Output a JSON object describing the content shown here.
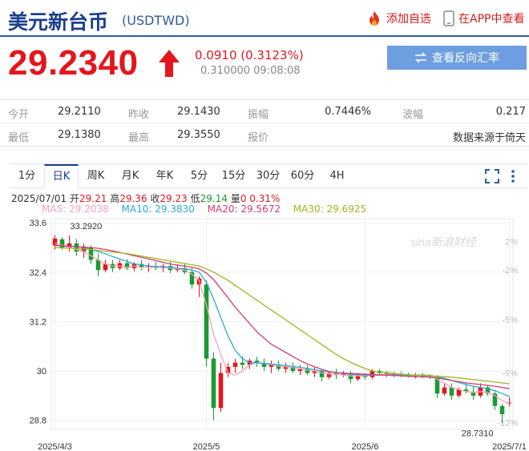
{
  "header": {
    "title": "美元新台币",
    "code": "(USDTWD)",
    "add_fav": "添加自选",
    "app_link": "在APP中查看"
  },
  "quote": {
    "price": "29.2340",
    "change": "0.0910 (0.3123%)",
    "subinfo": "0.310000 09:08:08",
    "reverse_button": "查看反向汇率"
  },
  "table": {
    "row1": [
      {
        "label": "今开",
        "value": "29.2110"
      },
      {
        "label": "昨收",
        "value": "29.1430"
      },
      {
        "label": "振幅",
        "value": "0.7446%"
      },
      {
        "label": "波幅",
        "value": "0.217"
      }
    ],
    "row2": [
      {
        "label": "最低",
        "value": "29.1380"
      },
      {
        "label": "最高",
        "value": "29.3550"
      },
      {
        "label": "报价",
        "value": "数据来源于倚天"
      }
    ]
  },
  "chart_tabs": [
    "1分",
    "日K",
    "周K",
    "月K",
    "年K",
    "5分",
    "15分",
    "30分",
    "60分",
    "4H"
  ],
  "active_tab": "日K",
  "ohlc": {
    "date": "2025/07/01",
    "open_label": "开",
    "open": "29.21",
    "high_label": "高",
    "high": "29.36",
    "close_label": "收",
    "close": "29.23",
    "low_label": "低",
    "low": "29.14",
    "vol_label": "量",
    "vol": "0",
    "pct": "0.31%"
  },
  "ma": {
    "ma5": "MA5: 29.2038",
    "ma10": "MA10: 29.3830",
    "ma20": "MA20: 29.5672",
    "ma30": "MA30: 29.6925"
  },
  "colors": {
    "up": "#e4161c",
    "down": "#1a9a32",
    "ma5": "#f3a3bb",
    "ma10": "#29a9d6",
    "ma20": "#d63a72",
    "ma30": "#9ab81e",
    "brand": "#1a3f8c"
  },
  "watermark": "sina新浪财经",
  "chart_data": {
    "type": "candlestick",
    "ylim": [
      28.6,
      33.7
    ],
    "y_ticks": [
      "33.6",
      "32.4",
      "31.2",
      "30",
      "28.8"
    ],
    "y_tick_values": [
      33.6,
      32.4,
      31.2,
      30.0,
      28.8
    ],
    "pct_ticks": [
      "2%",
      "-2%",
      "-5%",
      "-9%",
      "-13%"
    ],
    "pct_tick_values": [
      33.15,
      32.45,
      31.25,
      29.95,
      28.75
    ],
    "x_labels": [
      "2025/4/3",
      "2025/5",
      "2025/6",
      "2025/7/1"
    ],
    "x_label_index": [
      0,
      21,
      43,
      63
    ],
    "annotations": [
      {
        "text": "33.2920",
        "index": 3,
        "value": 33.292
      },
      {
        "text": "28.7310",
        "index": 61,
        "value": 28.731
      }
    ],
    "candles": [
      [
        33.05,
        33.3,
        32.95,
        33.22
      ],
      [
        33.2,
        33.25,
        32.95,
        33.0
      ],
      [
        33.0,
        33.29,
        32.9,
        33.1
      ],
      [
        33.1,
        33.2,
        32.8,
        32.9
      ],
      [
        32.9,
        33.1,
        32.75,
        33.0
      ],
      [
        33.0,
        33.05,
        32.6,
        32.7
      ],
      [
        32.7,
        32.85,
        32.3,
        32.45
      ],
      [
        32.45,
        32.7,
        32.4,
        32.6
      ],
      [
        32.6,
        32.7,
        32.4,
        32.5
      ],
      [
        32.5,
        32.7,
        32.45,
        32.62
      ],
      [
        32.62,
        32.72,
        32.45,
        32.5
      ],
      [
        32.5,
        32.65,
        32.42,
        32.6
      ],
      [
        32.6,
        32.7,
        32.45,
        32.52
      ],
      [
        32.52,
        32.62,
        32.4,
        32.55
      ],
      [
        32.55,
        32.65,
        32.45,
        32.5
      ],
      [
        32.5,
        32.6,
        32.4,
        32.55
      ],
      [
        32.55,
        32.65,
        32.38,
        32.45
      ],
      [
        32.45,
        32.6,
        32.4,
        32.5
      ],
      [
        32.5,
        32.6,
        32.35,
        32.4
      ],
      [
        32.4,
        32.5,
        32.0,
        32.1
      ],
      [
        32.1,
        32.3,
        31.8,
        32.25
      ],
      [
        32.1,
        32.2,
        30.1,
        30.3
      ],
      [
        30.3,
        30.45,
        28.8,
        29.1
      ],
      [
        29.1,
        30.2,
        29.0,
        29.95
      ],
      [
        29.95,
        30.2,
        29.85,
        30.1
      ],
      [
        30.1,
        30.3,
        29.95,
        30.2
      ],
      [
        30.2,
        30.35,
        30.05,
        30.15
      ],
      [
        30.15,
        30.3,
        30.05,
        30.25
      ],
      [
        30.25,
        30.35,
        30.1,
        30.2
      ],
      [
        30.2,
        30.3,
        30.0,
        30.1
      ],
      [
        30.1,
        30.25,
        29.95,
        30.15
      ],
      [
        30.15,
        30.25,
        30.0,
        30.05
      ],
      [
        30.05,
        30.2,
        29.95,
        30.1
      ],
      [
        30.1,
        30.2,
        29.95,
        30.0
      ],
      [
        30.0,
        30.15,
        29.9,
        30.05
      ],
      [
        30.05,
        30.15,
        29.9,
        29.95
      ],
      [
        29.95,
        30.1,
        29.85,
        30.0
      ],
      [
        30.0,
        30.05,
        29.75,
        29.85
      ],
      [
        29.85,
        30.0,
        29.8,
        29.95
      ],
      [
        29.95,
        30.05,
        29.8,
        29.9
      ],
      [
        29.9,
        30.0,
        29.85,
        29.95
      ],
      [
        29.95,
        30.0,
        29.7,
        29.8
      ],
      [
        29.8,
        29.95,
        29.75,
        29.9
      ],
      [
        29.9,
        29.95,
        29.8,
        29.85
      ],
      [
        29.85,
        30.05,
        29.8,
        30.0
      ],
      [
        30.0,
        30.05,
        29.9,
        29.95
      ],
      [
        29.95,
        30.0,
        29.85,
        29.9
      ],
      [
        29.9,
        29.98,
        29.85,
        29.92
      ],
      [
        29.92,
        29.98,
        29.85,
        29.9
      ],
      [
        29.9,
        29.96,
        29.84,
        29.88
      ],
      [
        29.88,
        29.95,
        29.82,
        29.9
      ],
      [
        29.9,
        29.95,
        29.82,
        29.86
      ],
      [
        29.86,
        29.92,
        29.8,
        29.84
      ],
      [
        29.84,
        29.9,
        29.35,
        29.45
      ],
      [
        29.45,
        29.7,
        29.4,
        29.6
      ],
      [
        29.6,
        29.7,
        29.3,
        29.4
      ],
      [
        29.4,
        29.6,
        29.35,
        29.55
      ],
      [
        29.55,
        29.7,
        29.45,
        29.5
      ],
      [
        29.5,
        29.62,
        29.3,
        29.4
      ],
      [
        29.4,
        29.7,
        29.35,
        29.6
      ],
      [
        29.6,
        29.65,
        29.4,
        29.45
      ],
      [
        29.45,
        29.5,
        29.05,
        29.15
      ],
      [
        29.15,
        29.2,
        28.73,
        28.95
      ],
      [
        29.21,
        29.36,
        29.14,
        29.23
      ]
    ],
    "series": [
      {
        "name": "MA5",
        "values": [
          33.1,
          33.05,
          33.0,
          32.95,
          32.9,
          32.8,
          32.7,
          32.6,
          32.55,
          32.55,
          32.52,
          32.55,
          32.52,
          32.52,
          32.52,
          32.52,
          32.5,
          32.48,
          32.45,
          32.35,
          32.2,
          31.6,
          30.9,
          30.4,
          29.95,
          29.9,
          30.0,
          30.15,
          30.2,
          30.18,
          30.15,
          30.12,
          30.1,
          30.08,
          30.05,
          30.02,
          30.0,
          29.95,
          29.92,
          29.92,
          29.9,
          29.88,
          29.88,
          29.88,
          29.9,
          29.92,
          29.92,
          29.92,
          29.92,
          29.9,
          29.9,
          29.9,
          29.88,
          29.8,
          29.7,
          29.6,
          29.55,
          29.5,
          29.48,
          29.5,
          29.48,
          29.4,
          29.28,
          29.2
        ]
      },
      {
        "name": "MA10",
        "values": [
          33.05,
          33.04,
          33.03,
          33.02,
          33.0,
          32.95,
          32.9,
          32.85,
          32.78,
          32.72,
          32.66,
          32.6,
          32.58,
          32.55,
          32.54,
          32.53,
          32.52,
          32.5,
          32.48,
          32.45,
          32.4,
          32.15,
          31.75,
          31.3,
          30.85,
          30.5,
          30.3,
          30.2,
          30.2,
          30.18,
          30.17,
          30.15,
          30.13,
          30.11,
          30.09,
          30.06,
          30.03,
          30.0,
          29.98,
          29.96,
          29.94,
          29.92,
          29.91,
          29.9,
          29.9,
          29.9,
          29.9,
          29.91,
          29.91,
          29.9,
          29.9,
          29.9,
          29.89,
          29.86,
          29.82,
          29.77,
          29.72,
          29.67,
          29.63,
          29.6,
          29.57,
          29.52,
          29.45,
          29.38
        ]
      },
      {
        "name": "MA20",
        "values": [
          33.05,
          33.04,
          33.03,
          33.02,
          33.01,
          33.0,
          32.98,
          32.95,
          32.92,
          32.88,
          32.84,
          32.8,
          32.76,
          32.72,
          32.68,
          32.64,
          32.6,
          32.57,
          32.55,
          32.52,
          32.48,
          32.38,
          32.22,
          32.0,
          31.78,
          31.55,
          31.35,
          31.15,
          30.95,
          30.8,
          30.65,
          30.55,
          30.45,
          30.35,
          30.25,
          30.17,
          30.1,
          30.04,
          29.99,
          29.96,
          29.95,
          29.94,
          29.93,
          29.92,
          29.91,
          29.9,
          29.9,
          29.89,
          29.88,
          29.87,
          29.86,
          29.86,
          29.85,
          29.83,
          29.8,
          29.77,
          29.74,
          29.71,
          29.69,
          29.67,
          29.65,
          29.63,
          29.6,
          29.57
        ]
      },
      {
        "name": "MA30",
        "values": [
          33.0,
          32.99,
          32.98,
          32.97,
          32.96,
          32.95,
          32.93,
          32.91,
          32.89,
          32.87,
          32.85,
          32.82,
          32.79,
          32.76,
          32.73,
          32.7,
          32.67,
          32.64,
          32.61,
          32.58,
          32.55,
          32.48,
          32.4,
          32.3,
          32.2,
          32.08,
          31.96,
          31.84,
          31.72,
          31.6,
          31.48,
          31.36,
          31.24,
          31.12,
          31.0,
          30.88,
          30.76,
          30.64,
          30.52,
          30.4,
          30.3,
          30.21,
          30.13,
          30.06,
          30.0,
          29.98,
          29.96,
          29.94,
          29.92,
          29.91,
          29.9,
          29.89,
          29.88,
          29.87,
          29.86,
          29.85,
          29.83,
          29.81,
          29.79,
          29.77,
          29.75,
          29.73,
          29.71,
          29.69
        ]
      }
    ]
  }
}
